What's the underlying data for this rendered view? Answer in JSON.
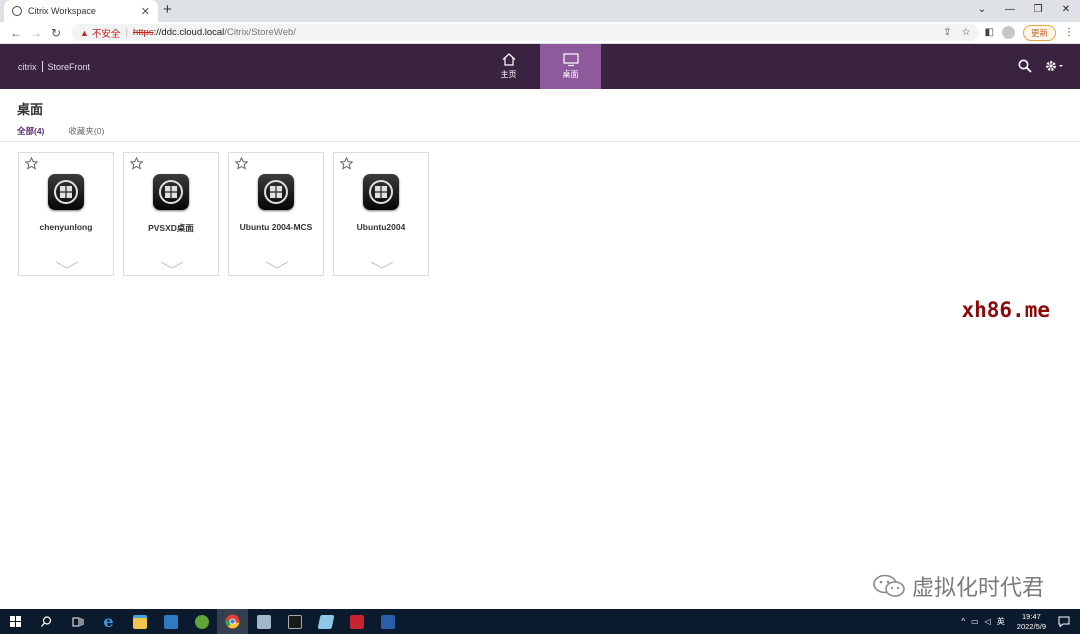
{
  "browser": {
    "tab_title": "Citrix Workspace",
    "tab_close": "✕",
    "new_tab": "+",
    "insecure_label": "不安全",
    "url_scheme": "https",
    "url_host": "://ddc.cloud.local",
    "url_path": "/Citrix/StoreWeb/",
    "update_label": "更新"
  },
  "storefront": {
    "logo_brand": "citrix",
    "logo_product": "StoreFront",
    "nav": [
      {
        "label": "主页",
        "icon": "home-icon"
      },
      {
        "label": "桌面",
        "icon": "monitor-icon",
        "active": true
      }
    ]
  },
  "page": {
    "title": "桌面",
    "filters": {
      "all": "全部(4)",
      "favorites": "收藏夹(0)"
    },
    "desktops": [
      {
        "name": "chenyunlong"
      },
      {
        "name": "PVSXD桌面"
      },
      {
        "name": "Ubuntu 2004-MCS"
      },
      {
        "name": "Ubuntu2004"
      }
    ]
  },
  "overlays": {
    "watermark": "xh86.me",
    "wechat_account": "虚拟化时代君"
  },
  "taskbar": {
    "ime_label": "英",
    "time": "19:47",
    "date": "2022/5/9"
  },
  "colors": {
    "header_bg": "#3a2340",
    "active_tab": "#8f5a9c",
    "accent": "#5b2c6f",
    "watermark": "#8b0a0a"
  }
}
